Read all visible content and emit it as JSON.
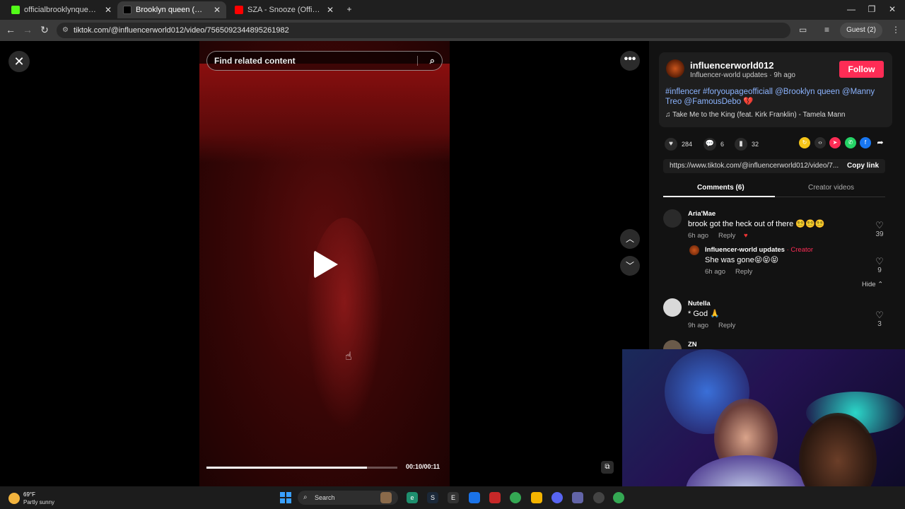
{
  "browser": {
    "tabs": [
      {
        "title": "officialbrooklynqueen Stream -",
        "favicon_color": "#53fc18",
        "active": false
      },
      {
        "title": "Brooklyn queen (@brooklyn",
        "favicon_color": "#000000",
        "active": true
      },
      {
        "title": "SZA - Snooze (Official Video) -",
        "favicon_color": "#ff0000",
        "active": false
      }
    ],
    "url": "tiktok.com/@influencerworld012/video/7565092344895261982",
    "profile_label": "Guest (2)"
  },
  "video": {
    "search_placeholder": "Find related content",
    "time": "00:10/00:11",
    "progress": 0.84
  },
  "post": {
    "username": "influencerworld012",
    "subtitle": "Influencer-world updates · 9h ago",
    "follow_label": "Follow",
    "description": "#inflencer #foryoupageofficiall @Brooklyn queen @Manny Treo @FamousDebo",
    "music": "Take Me to the King (feat. Kirk Franklin) - Tamela Mann",
    "likes": "284",
    "comments_count": "6",
    "saves": "32",
    "link": "https://www.tiktok.com/@influencerworld012/video/7...",
    "copy_link_label": "Copy link",
    "tabs": [
      "Comments (6)",
      "Creator videos"
    ]
  },
  "comments": [
    {
      "name": "Aria'Mae",
      "text": "brook got the heck out of there 😵‍💫😵‍💫😵‍💫",
      "time": "6h ago",
      "reply": "Reply",
      "likes": "39"
    },
    {
      "name": "Influencer-world updates",
      "badge": "· Creator",
      "text": "She was gone😝😝😝",
      "time": "6h ago",
      "reply": "Reply",
      "likes": "9"
    },
    {
      "name": "Nutella",
      "text": "* God 🙏",
      "time": "9h ago",
      "reply": "Reply",
      "likes": "3"
    },
    {
      "name": "ZN"
    }
  ],
  "hide_label": "Hide",
  "taskbar": {
    "temp": "69°F",
    "weather": "Partly sunny",
    "search_label": "Search"
  },
  "colors": {
    "accent": "#fe2c55",
    "link": "#8cb4ff",
    "creator": "#fe2c55"
  }
}
